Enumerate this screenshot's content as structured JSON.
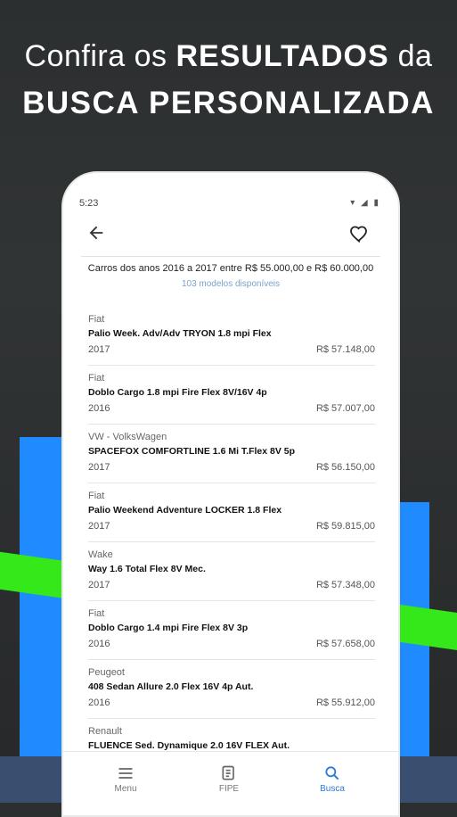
{
  "promo": {
    "line1_pre": "Confira os",
    "line1_bold": "RESULTADOS",
    "line1_post": "da",
    "line2": "BUSCA PERSONALIZADA"
  },
  "status": {
    "time": "5:23"
  },
  "search": {
    "summary": "Carros dos anos 2016 a 2017 entre R$  55.000,00 e R$ 60.000,00",
    "count": "103 modelos disponíveis"
  },
  "results": [
    {
      "brand": "Fiat",
      "model": "Palio Week. Adv/Adv TRYON 1.8 mpi Flex",
      "year": "2017",
      "price": "R$  57.148,00"
    },
    {
      "brand": "Fiat",
      "model": "Doblo Cargo 1.8 mpi Fire Flex 8V/16V 4p",
      "year": "2016",
      "price": "R$  57.007,00"
    },
    {
      "brand": "VW - VolksWagen",
      "model": "SPACEFOX COMFORTLINE 1.6 Mi T.Flex 8V 5p",
      "year": "2017",
      "price": "R$  56.150,00"
    },
    {
      "brand": "Fiat",
      "model": "Palio Weekend Adventure LOCKER 1.8 Flex",
      "year": "2017",
      "price": "R$  59.815,00"
    },
    {
      "brand": "Wake",
      "model": "Way 1.6 Total Flex 8V Mec.",
      "year": "2017",
      "price": "R$  57.348,00"
    },
    {
      "brand": "Fiat",
      "model": "Doblo  Cargo 1.4 mpi Fire Flex 8V 3p",
      "year": "2016",
      "price": "R$  57.658,00"
    },
    {
      "brand": "Peugeot",
      "model": "408 Sedan Allure 2.0 Flex 16V 4p Aut.",
      "year": "2016",
      "price": "R$  55.912,00"
    },
    {
      "brand": "Renault",
      "model": "FLUENCE Sed. Dynamique 2.0 16V FLEX Aut.",
      "year": "",
      "price": ""
    }
  ],
  "nav": {
    "menu": "Menu",
    "fipe": "FIPE",
    "busca": "Busca"
  },
  "colors": {
    "accent": "#2a7bd8",
    "bar_blue": "#1f8bff",
    "stripe_green": "#35e81a"
  }
}
